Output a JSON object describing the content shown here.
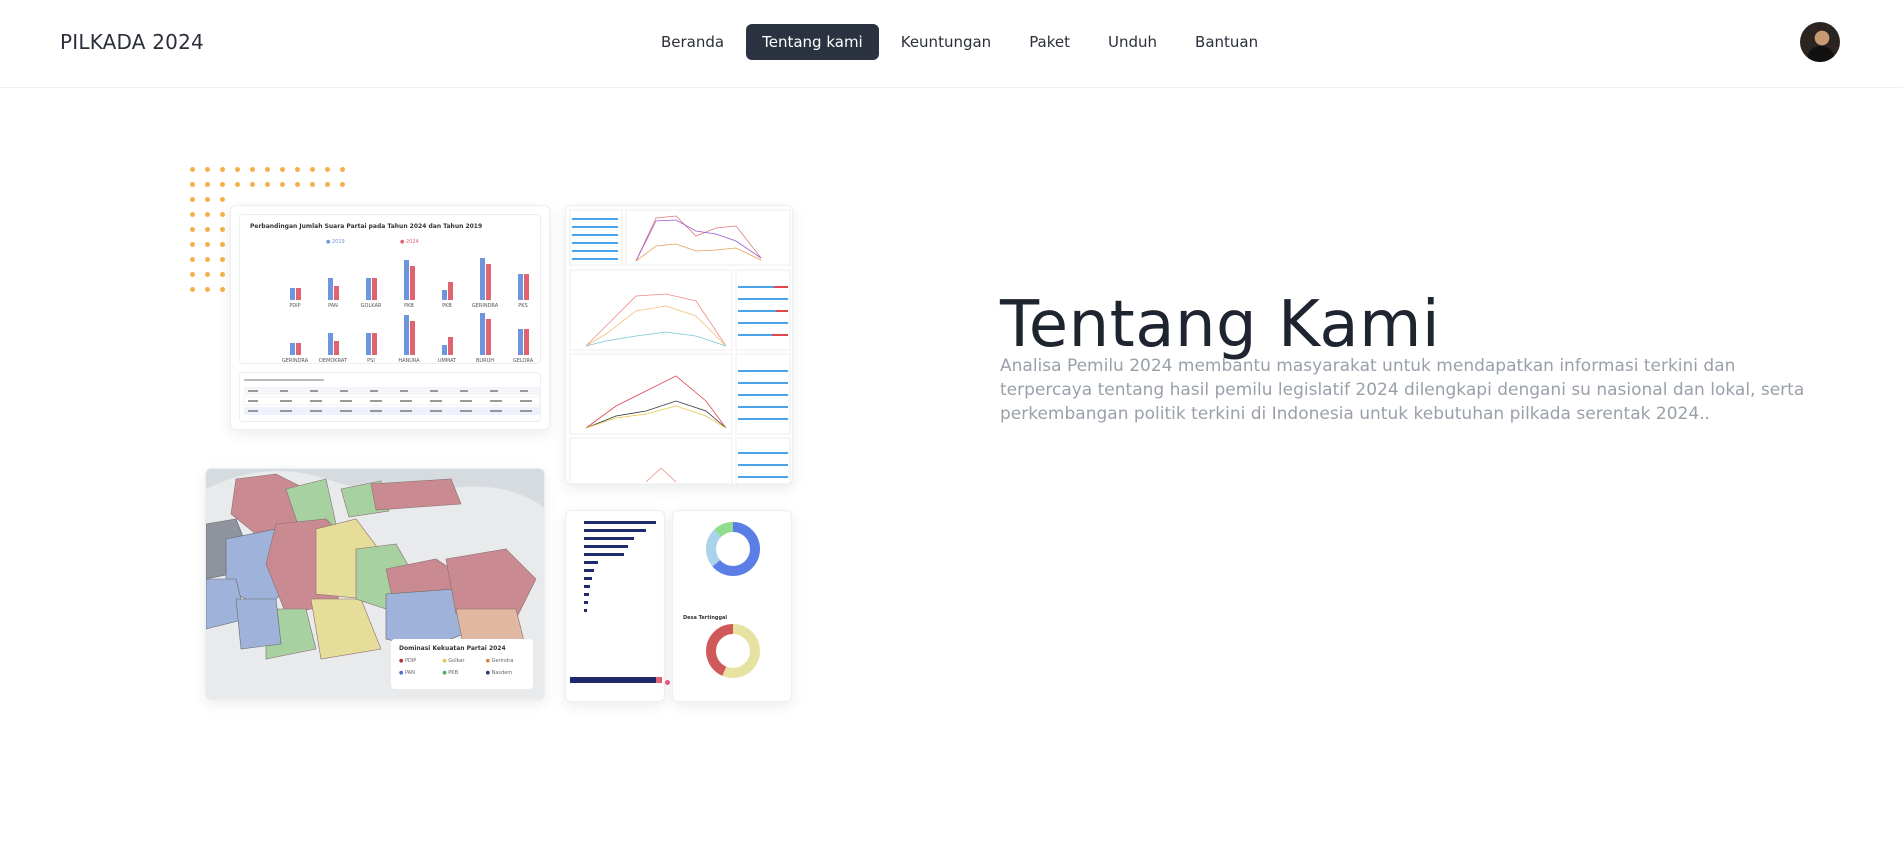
{
  "brand": "PILKADA 2024",
  "nav": {
    "items": [
      {
        "label": "Beranda",
        "active": false
      },
      {
        "label": "Tentang kami",
        "active": true
      },
      {
        "label": "Keuntungan",
        "active": false
      },
      {
        "label": "Paket",
        "active": false
      },
      {
        "label": "Unduh",
        "active": false
      },
      {
        "label": "Bantuan",
        "active": false
      }
    ]
  },
  "hero": {
    "title": "Tentang Kami",
    "description": "Analisa Pemilu 2024 membantu masyarakat untuk mendapatkan informasi terkini dan terpercaya tentang hasil pemilu legislatif 2024 dilengkapi dengani su nasional dan lokal, serta perkembangan politik terkini di Indonesia untuk kebutuhan pilkada serentak 2024.."
  },
  "collage": {
    "bar_card": {
      "title": "Perbandingan Jumlah Suara Partai pada Tahun 2024 dan Tahun 2019",
      "legend": [
        "2019",
        "2024"
      ],
      "row1": [
        "PDIP",
        "PAN",
        "GOLKAR",
        "PKB",
        "PKB",
        "GERINDRA",
        "PKS"
      ],
      "row2": [
        "GERINDRA",
        "DEMOKRAT",
        "PSI",
        "HANURA",
        "UMMAT",
        "BURUH",
        "GELORA"
      ],
      "colors": {
        "y2019": "#6f95de",
        "y2024": "#e0646f"
      }
    },
    "map_card": {
      "legend_title": "Dominasi Kekuatan Partai 2024",
      "legend": [
        {
          "label": "PDIP",
          "color": "#b3313a"
        },
        {
          "label": "Golkar",
          "color": "#e6c84a"
        },
        {
          "label": "Gerindra",
          "color": "#c98a4a"
        },
        {
          "label": "PAN",
          "color": "#4a6fd1"
        },
        {
          "label": "PKB",
          "color": "#4aa86a"
        },
        {
          "label": "Nasdem",
          "color": "#2b3a7a"
        }
      ]
    },
    "donut_card": {
      "title": "Desa Tertinggal"
    }
  }
}
